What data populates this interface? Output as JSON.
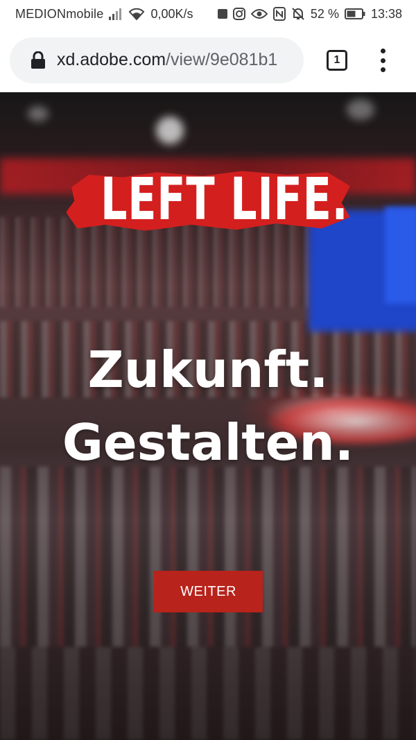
{
  "status_bar": {
    "carrier": "MEDIONmobile",
    "net_speed": "0,00K/s",
    "battery_percent": "52 %",
    "time": "13:38",
    "icons": [
      "signal-icon",
      "wifi-icon",
      "stop-icon",
      "instagram-icon",
      "eye-icon",
      "nfc-icon",
      "bell-off-icon",
      "battery-icon"
    ]
  },
  "browser": {
    "url_host": "xd.adobe.com",
    "url_path": "/view/9e081b1",
    "tab_count": "1",
    "icons": [
      "lock-icon",
      "tabs-icon",
      "more-vert-icon"
    ]
  },
  "hero": {
    "logo_text": "LEFT LIFE.",
    "headline_line1": "Zukunft.",
    "headline_line2": "Gestalten.",
    "cta_label": "WEITER"
  },
  "colors": {
    "accent_red": "#d41f1f",
    "cta_red": "#b8231c",
    "text_white": "#ffffff",
    "chrome_bg": "#ffffff",
    "url_pill_bg": "#f1f3f4"
  }
}
